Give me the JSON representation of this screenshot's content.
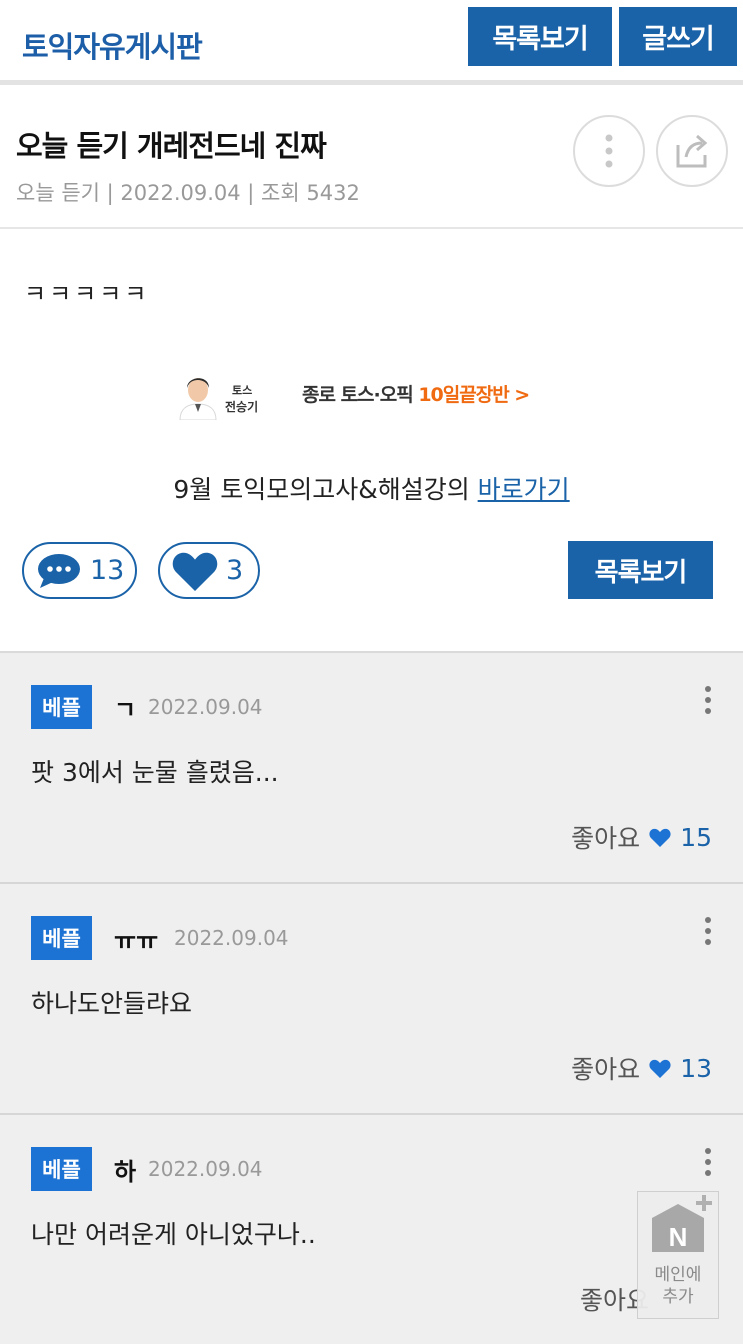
{
  "header": {
    "board_title": "토익자유게시판",
    "list_button": "목록보기",
    "write_button": "글쓰기"
  },
  "post": {
    "title": "오늘 듣기 개레전드네 진짜",
    "meta": "오늘 듣기 | 2022.09.04 | 조회 5432",
    "body": "ㅋㅋㅋㅋㅋ"
  },
  "ad": {
    "brand_line1": "토스",
    "brand_line2": "전승기",
    "text": "종로 토스·오픽 ",
    "highlight": "10일끝장반 >"
  },
  "promo": {
    "text": "9월 토익모의고사&해설강의 ",
    "link": "바로가기"
  },
  "actions": {
    "comment_count": "13",
    "like_count": "3",
    "list_button": "목록보기"
  },
  "comments": [
    {
      "badge": "베플",
      "author": "ㄱ",
      "date": "2022.09.04",
      "text": "팟 3에서 눈물 흘렸음...",
      "like_label": "좋아요",
      "like_count": "15"
    },
    {
      "badge": "베플",
      "author": "ㅠㅠ",
      "date": "2022.09.04",
      "text": "하나도안들랴요",
      "like_label": "좋아요",
      "like_count": "13"
    },
    {
      "badge": "베플",
      "author": "하",
      "date": "2022.09.04",
      "text": "나만 어려운게 아니었구나..",
      "like_label": "좋아요",
      "like_count": ""
    }
  ],
  "floating": {
    "icon_letter": "N",
    "label_line1": "메인에",
    "label_line2": "추가"
  },
  "colors": {
    "brand_blue": "#1b63a8",
    "badge_blue": "#1d73d4",
    "ad_orange": "#f06a12"
  }
}
